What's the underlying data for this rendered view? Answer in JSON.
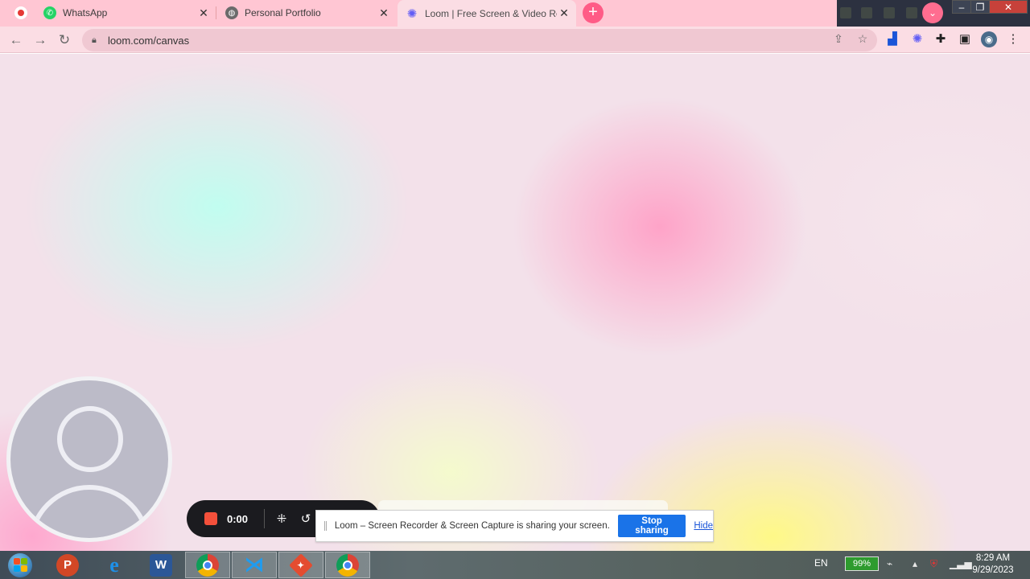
{
  "browser": {
    "tabs": [
      {
        "title": "WhatsApp",
        "icon": "whatsapp-icon",
        "active": false
      },
      {
        "title": "Personal Portfolio",
        "icon": "globe-icon",
        "active": false
      },
      {
        "title": "Loom | Free Screen & Video Rec",
        "icon": "loom-icon",
        "active": true
      }
    ],
    "new_tab_label": "+",
    "url": "loom.com/canvas"
  },
  "recorder": {
    "timer": "0:00"
  },
  "share_bar": {
    "message": "Loom – Screen Recorder & Screen Capture is sharing your screen.",
    "stop_label": "Stop sharing",
    "hide_label": "Hide"
  },
  "taskbar": {
    "apps": [
      "PowerPoint",
      "Internet Explorer",
      "Word",
      "Chrome",
      "Visual Studio Code",
      "Git",
      "Chrome"
    ],
    "language": "EN",
    "battery": "99%",
    "time": "8:29 AM",
    "date": "9/29/2023"
  },
  "colors": {
    "tab_strip": "#ffc6d3",
    "accent_pink": "#ff5b86",
    "stop_button": "#1a73e8",
    "record_stop": "#f4503b"
  }
}
